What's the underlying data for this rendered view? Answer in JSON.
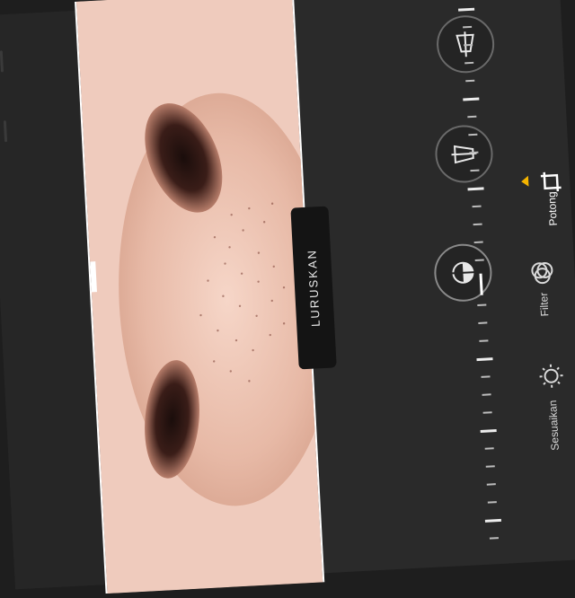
{
  "editor": {
    "straighten_label": "LURUSKAN",
    "tabs": [
      {
        "label": "Sesuaikan",
        "icon": "adjust-dial-icon",
        "active": false
      },
      {
        "label": "Filter",
        "icon": "filter-circles-icon",
        "active": false
      },
      {
        "label": "Potong",
        "icon": "crop-rotate-icon",
        "active": true
      }
    ],
    "tools": [
      {
        "name": "vertical-perspective",
        "icon": "vertical-perspective-icon"
      },
      {
        "name": "horizontal-perspective",
        "icon": "horizontal-perspective-icon"
      },
      {
        "name": "straighten",
        "icon": "straighten-icon",
        "active": true
      }
    ],
    "accent_color": "#f4b400"
  }
}
